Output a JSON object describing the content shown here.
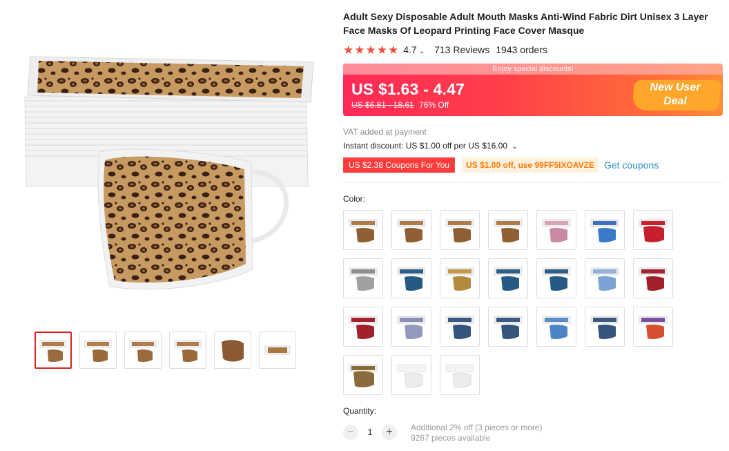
{
  "product": {
    "title": "Adult Sexy Disposable Adult Mouth Masks Anti-Wind Fabric Dirt Unisex 3 Layer Face Masks Of Leopard Printing Face Cover Masque",
    "rating": "4.7",
    "reviews": "713 Reviews",
    "orders": "1943 orders"
  },
  "price": {
    "banner_top": "Enjoy special discounts!",
    "range": "US $1.63 - 4.47",
    "original": "US $6.81 - 18.61",
    "discount": "76% Off",
    "new_user_line1": "New User",
    "new_user_line2": "Deal"
  },
  "vat": "VAT added at payment",
  "instant_discount": "Instant discount: US $1.00 off per US $16.00",
  "coupons": {
    "red": "US $2.38 Coupons For You",
    "code": "US $1.00 off, use 99FF5IXOAVZE",
    "get": "Get coupons"
  },
  "color_label": "Color:",
  "quantity": {
    "label": "Quantity:",
    "value": "1",
    "additional": "Additional 2% off (3 pieces or more)",
    "available": "9267 pieces available"
  },
  "colors": {
    "accent": "#ff3a3a",
    "link": "#2e8ac6",
    "star": "#f04f3f"
  }
}
